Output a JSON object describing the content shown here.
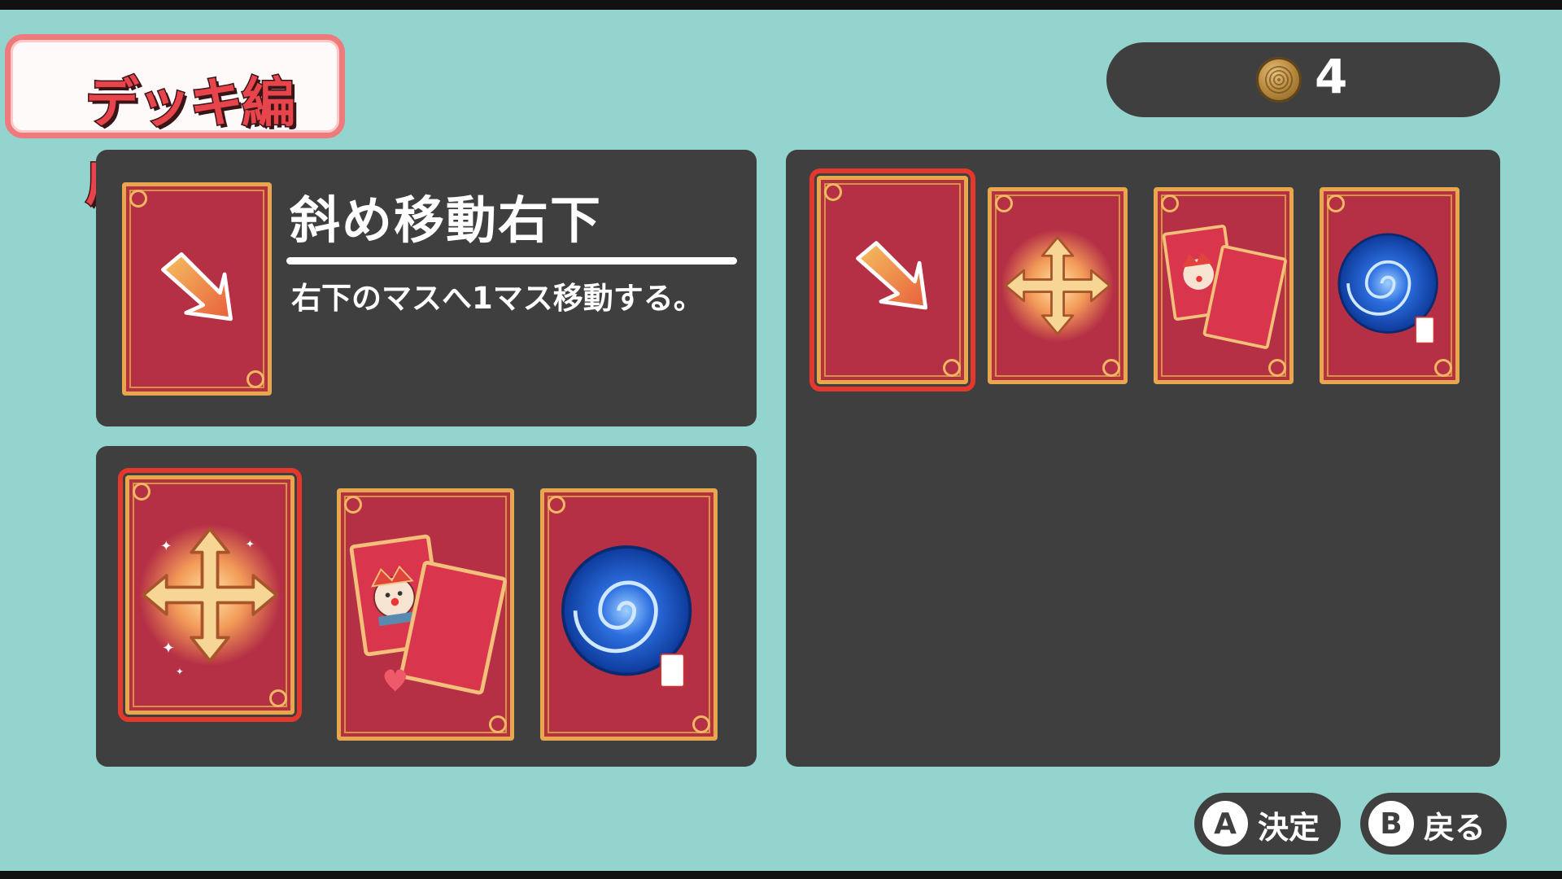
{
  "header": {
    "title": "デッキ編成"
  },
  "currency": {
    "icon": "coin-icon",
    "count": "4"
  },
  "detail": {
    "card_icon": "diagonal-arrow-down-right-icon",
    "name": "斜め移動右下",
    "description": "右下のマスへ1マス移動する。"
  },
  "hand_cards": [
    {
      "icon": "four-way-arrows-icon",
      "selected": true
    },
    {
      "icon": "joker-cards-icon",
      "selected": false
    },
    {
      "icon": "blue-vortex-icon",
      "selected": false
    }
  ],
  "deck_cards": [
    {
      "icon": "diagonal-arrow-down-right-icon",
      "selected": true
    },
    {
      "icon": "four-way-arrows-icon",
      "selected": false
    },
    {
      "icon": "joker-cards-icon",
      "selected": false
    },
    {
      "icon": "blue-vortex-icon",
      "selected": false
    }
  ],
  "controls": {
    "confirm": {
      "key": "A",
      "label": "決定"
    },
    "back": {
      "key": "B",
      "label": "戻る"
    }
  },
  "colors": {
    "background": "#94d4ce",
    "panel": "#3f3f3f",
    "card": "#b52f45",
    "card_border": "#e8a74c",
    "selection": "#e6372c",
    "title_text": "#e8444c"
  }
}
